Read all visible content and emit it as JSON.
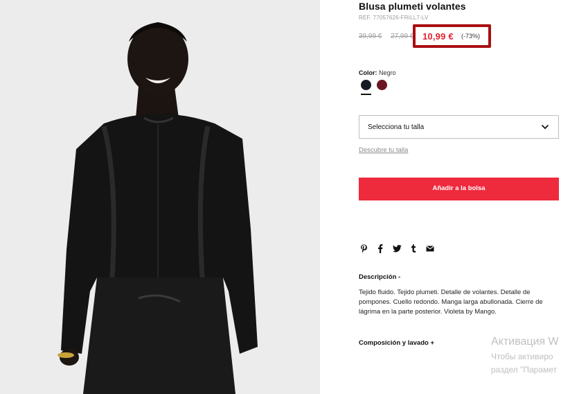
{
  "product": {
    "title": "Blusa plumeti volantes",
    "ref": "REF. 77057626-FRILL7-LV",
    "old_price_1": "39,99 €",
    "old_price_2": "27,99 €",
    "sale_price": "10,99 €",
    "discount": "(-73%)"
  },
  "color": {
    "label": "Color:",
    "value": "Negro",
    "swatches": [
      "#161a24",
      "#6b1622"
    ]
  },
  "size": {
    "placeholder": "Selecciona tu talla",
    "guide_link": "Descubre tu talla"
  },
  "cart": {
    "add_label": "Añadir a la bolsa"
  },
  "share": {
    "icons": [
      "pinterest-icon",
      "facebook-icon",
      "twitter-icon",
      "tumblr-icon",
      "email-icon"
    ]
  },
  "description": {
    "heading": "Descripción -",
    "text": "Tejido fluido. Tejido plumeti. Detalle de volantes. Detalle de pompones. Cuello redondo. Manga larga abullonada. Cierre de lágrima en la parte posterior. Violeta by Mango."
  },
  "composition": {
    "heading": "Composición y lavado +"
  },
  "watermark": {
    "line1": "Активация W",
    "line2": "Чтобы активиро",
    "line3": "раздел \"Парамет"
  },
  "colors": {
    "accent_red": "#ee2a3d",
    "price_red": "#e4202c",
    "highlight_box": "#a90e12"
  }
}
